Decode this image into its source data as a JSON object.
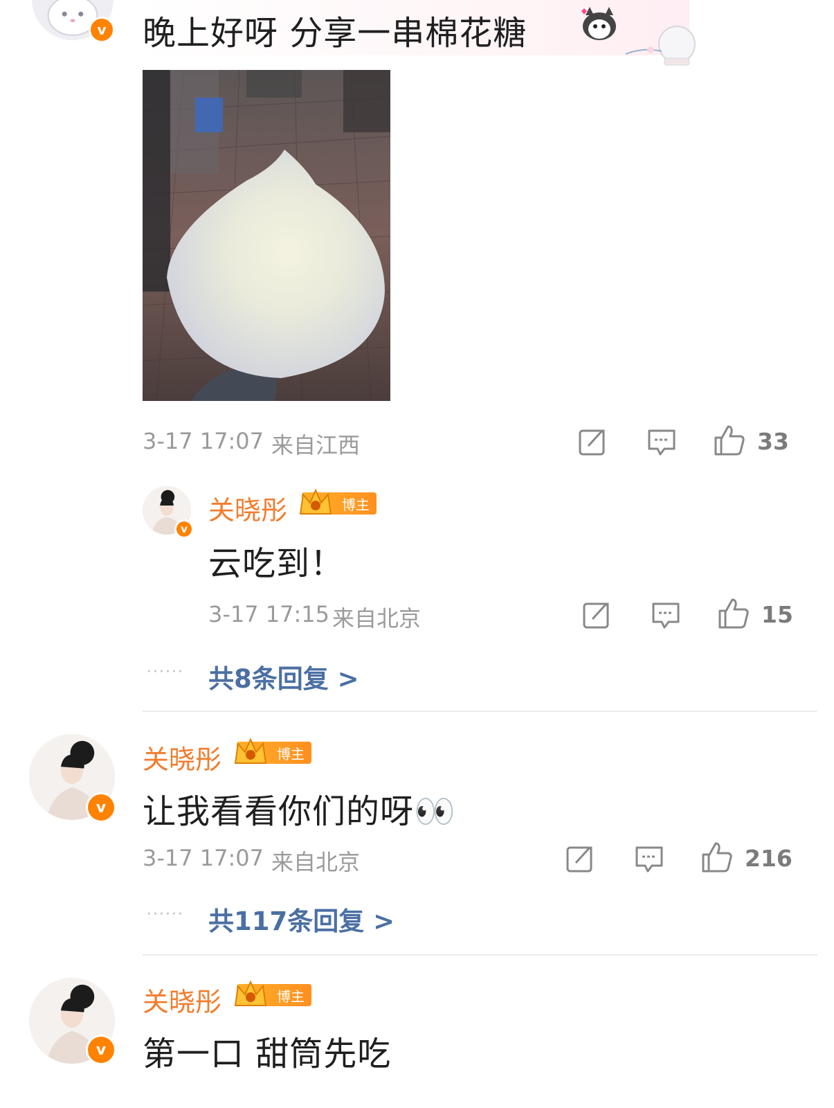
{
  "top_comment": {
    "text": "晚上好呀 分享一串棉花糖",
    "time": "3-17 17:07",
    "location": "来自江西",
    "likes": "33"
  },
  "reply_in_thread": {
    "username": "关晓彤",
    "badge": "博主",
    "text": "云吃到！",
    "time": "3-17 17:15",
    "location": "来自北京",
    "likes": "15",
    "more_replies": "共8条回复 >"
  },
  "comment_2": {
    "username": "关晓彤",
    "badge": "博主",
    "text": "让我看看你们的呀👀",
    "time": "3-17 17:07",
    "location": "来自北京",
    "likes": "216",
    "more_replies": "共117条回复 >"
  },
  "comment_3": {
    "username": "关晓彤",
    "badge": "博主",
    "text": "第一口 甜筒先吃"
  },
  "colors": {
    "username": "#f27c2c",
    "reply_link": "#4b6fa3",
    "meta": "#9a9a9a",
    "verified": "#ff8200"
  },
  "icons": [
    "repost-icon",
    "comment-icon",
    "like-icon",
    "verified-icon",
    "crown-icon"
  ]
}
